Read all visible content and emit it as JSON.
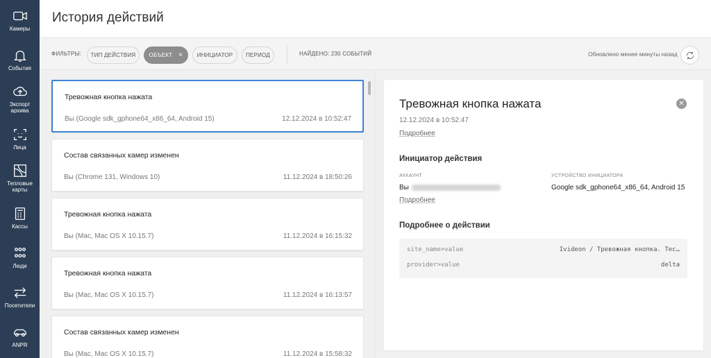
{
  "sidebar": {
    "items": [
      {
        "label": "Камеры",
        "icon": "camera-icon"
      },
      {
        "label": "События",
        "icon": "bell-icon"
      },
      {
        "label": "Экспорт архива",
        "icon": "cloud-upload-icon"
      },
      {
        "label": "Лица",
        "icon": "face-icon"
      },
      {
        "label": "Тепловые карты",
        "icon": "heatmap-icon"
      },
      {
        "label": "Кассы",
        "icon": "cash-register-icon"
      },
      {
        "label": "Люди",
        "icon": "people-icon"
      },
      {
        "label": "Посетители",
        "icon": "arrows-icon"
      },
      {
        "label": "ANPR",
        "icon": "car-icon"
      }
    ]
  },
  "header": {
    "title": "История действий"
  },
  "filters": {
    "label": "ФИЛЬТРЫ:",
    "chips": [
      {
        "label": "ТИП ДЕЙСТВИЯ",
        "active": false
      },
      {
        "label": "ОБЪЕКТ",
        "active": true,
        "clear": "×"
      },
      {
        "label": "ИНИЦИАТОР",
        "active": false
      },
      {
        "label": "ПЕРИОД",
        "active": false
      }
    ],
    "found": "НАЙДЕНО: 230 СОБЫТИЙ",
    "updated": "Обновлено менее минуты назад"
  },
  "events": [
    {
      "title": "Тревожная кнопка нажата",
      "device": "Вы (Google sdk_gphone64_x86_64, Android 15)",
      "date": "12.12.2024 в 10:52:47"
    },
    {
      "title": "Состав связанных камер изменен",
      "device": "Вы (Chrome 131, Windows 10)",
      "date": "11.12.2024 в 18:50:26"
    },
    {
      "title": "Тревожная кнопка нажата",
      "device": "Вы (Mac, Mac OS X 10.15.7)",
      "date": "11.12.2024 в 16:15:32"
    },
    {
      "title": "Тревожная кнопка нажата",
      "device": "Вы (Mac, Mac OS X 10.15.7)",
      "date": "11.12.2024 в 16:13:57"
    },
    {
      "title": "Состав связанных камер изменен",
      "device": "Вы (Mac, Mac OS X 10.15.7)",
      "date": "11.12.2024 в 15:58:32"
    }
  ],
  "detail": {
    "title": "Тревожная кнопка нажата",
    "date": "12.12.2024 в 10:52:47",
    "more_link": "Подробнее",
    "initiator_section": "Инициатор действия",
    "account_label": "АККАУНТ",
    "account_value": "Вы",
    "device_label": "УСТРОЙСТВО ИНИЦИАТОРА",
    "device_value": "Google sdk_gphone64_x86_64, Android 15",
    "account_more_link": "Подробнее",
    "details_section": "Подробнее о действии",
    "params": [
      {
        "key": "site_name>value",
        "value": "Ivideon / Тревожная кнопка. Тес…"
      },
      {
        "key": "provider>value",
        "value": "delta"
      }
    ]
  }
}
